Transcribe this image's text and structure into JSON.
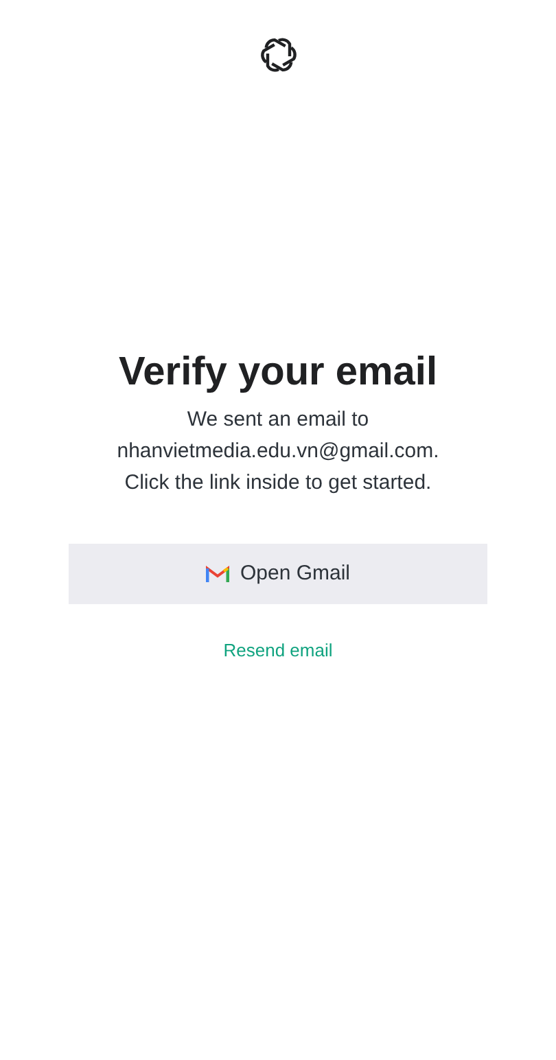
{
  "title": "Verify your email",
  "message_lines": [
    "We sent an email to",
    "nhanvietmedia.edu.vn@gmail.com.",
    "Click the link inside to get started."
  ],
  "primary_button": {
    "label": "Open Gmail"
  },
  "link": {
    "label": "Resend email"
  }
}
